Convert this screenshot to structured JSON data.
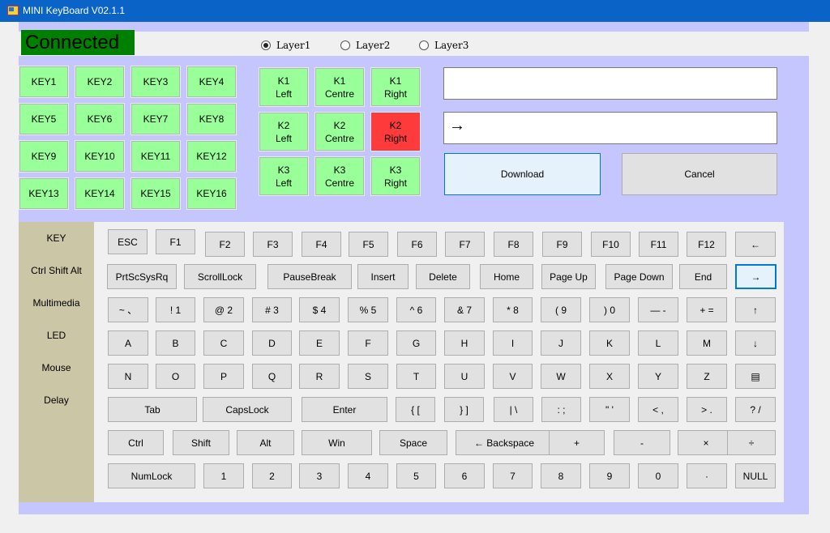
{
  "window": {
    "title": "MINI KeyBoard V02.1.1"
  },
  "status": {
    "text": "Connected",
    "color": "#008000"
  },
  "layers": [
    {
      "label": "Layer1",
      "selected": true
    },
    {
      "label": "Layer2",
      "selected": false
    },
    {
      "label": "Layer3",
      "selected": false
    }
  ],
  "keys_grid": [
    "KEY1",
    "KEY2",
    "KEY3",
    "KEY4",
    "KEY5",
    "KEY6",
    "KEY7",
    "KEY8",
    "KEY9",
    "KEY10",
    "KEY11",
    "KEY12",
    "KEY13",
    "KEY14",
    "KEY15",
    "KEY16"
  ],
  "knobs": [
    {
      "line1": "K1",
      "line2": "Left"
    },
    {
      "line1": "K1",
      "line2": "Centre"
    },
    {
      "line1": "K1",
      "line2": "Right"
    },
    {
      "line1": "K2",
      "line2": "Left"
    },
    {
      "line1": "K2",
      "line2": "Centre"
    },
    {
      "line1": "K2",
      "line2": "Right",
      "active": true
    },
    {
      "line1": "K3",
      "line2": "Left"
    },
    {
      "line1": "K3",
      "line2": "Centre"
    },
    {
      "line1": "K3",
      "line2": "Right"
    }
  ],
  "fields": {
    "top_value": "",
    "mapping_value": "→"
  },
  "buttons": {
    "download": "Download",
    "cancel": "Cancel"
  },
  "sidebar": [
    "KEY",
    "Ctrl Shift Alt",
    "Multimedia",
    "LED",
    "Mouse",
    "Delay"
  ],
  "keyboard": {
    "rows": [
      [
        "ESC",
        "F1",
        "F2",
        "F3",
        "F4",
        "F5",
        "F6",
        "F7",
        "F8",
        "F9",
        "F10",
        "F11",
        "F12",
        "←"
      ],
      [
        "PrtScSysRq",
        "ScrollLock",
        "PauseBreak",
        "Insert",
        "Delete",
        "Home",
        "Page Up",
        "Page Down",
        "End",
        "→"
      ],
      [
        "~ 、",
        "! 1",
        "@ 2",
        "# 3",
        "$ 4",
        "% 5",
        "^ 6",
        "& 7",
        "* 8",
        "( 9",
        ") 0",
        "— -",
        "+ =",
        "↑"
      ],
      [
        "A",
        "B",
        "C",
        "D",
        "E",
        "F",
        "G",
        "H",
        "I",
        "J",
        "K",
        "L",
        "M",
        "↓"
      ],
      [
        "N",
        "O",
        "P",
        "Q",
        "R",
        "S",
        "T",
        "U",
        "V",
        "W",
        "X",
        "Y",
        "Z",
        "▤"
      ],
      [
        "Tab",
        "CapsLock",
        "Enter",
        "{ [",
        "} ]",
        "| \\",
        ": ;",
        "\" '",
        "< ,",
        "> .",
        "? /"
      ],
      [
        "Ctrl",
        "Shift",
        "Alt",
        "Win",
        "Space",
        "← Backspace",
        "+",
        "-",
        "×",
        "÷"
      ],
      [
        "NumLock",
        "1",
        "2",
        "3",
        "4",
        "5",
        "6",
        "7",
        "8",
        "9",
        "0",
        "·",
        "NULL"
      ]
    ],
    "focused_key": "→"
  },
  "colors": {
    "key_green": "#99ff99",
    "key_active": "#ff3a3a",
    "panel": "#c6c6ff",
    "title_bar": "#0a64c8"
  }
}
